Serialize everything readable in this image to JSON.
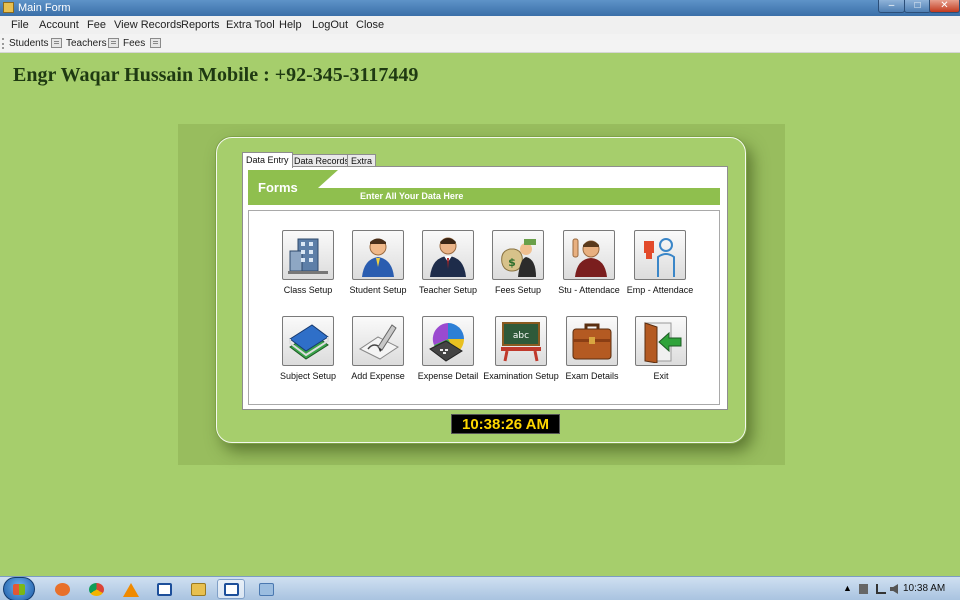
{
  "window": {
    "title": "Main Form",
    "controls": {
      "minimize": "–",
      "maximize": "□",
      "close": "✕"
    }
  },
  "menu": [
    "File",
    "Account",
    "Fee",
    "View Records",
    "Reports",
    "Extra Tool",
    "Help",
    "LogOut",
    "Close"
  ],
  "toolbar": [
    "Students",
    "Teachers",
    "Fees"
  ],
  "contact_text": "Engr Waqar Hussain Mobile : +92-345-3117449",
  "tabs": [
    "Data Entry",
    "Data Records",
    "Extra"
  ],
  "active_tab": "Data Entry",
  "banner": {
    "title": "Forms",
    "subtitle": "Enter All Your Data Here"
  },
  "tiles": [
    {
      "label": "Class Setup",
      "icon": "building-icon"
    },
    {
      "label": "Student Setup",
      "icon": "student-icon"
    },
    {
      "label": "Teacher Setup",
      "icon": "teacher-icon"
    },
    {
      "label": "Fees Setup",
      "icon": "money-bag-icon"
    },
    {
      "label": "Stu - Attendace",
      "icon": "raised-hand-icon"
    },
    {
      "label": "Emp - Attendace",
      "icon": "employee-icon"
    },
    {
      "label": "Subject Setup",
      "icon": "books-icon"
    },
    {
      "label": "Add Expense",
      "icon": "pencil-paper-icon"
    },
    {
      "label": "Expense Detail",
      "icon": "calculator-chart-icon"
    },
    {
      "label": "Examination Setup",
      "icon": "blackboard-icon"
    },
    {
      "label": "Exam Details",
      "icon": "briefcase-icon"
    },
    {
      "label": "Exit",
      "icon": "exit-door-icon"
    }
  ],
  "clock": "10:38:26 AM",
  "taskbar": {
    "time": "10:38 AM",
    "apps": [
      "firefox-icon",
      "chrome-icon",
      "vlc-icon",
      "window-icon",
      "explorer-icon",
      "main-form-icon",
      "app-icon"
    ]
  },
  "colors": {
    "background": "#a6ce6c",
    "banner": "#8fbf4e",
    "clock_text": "#ffd700",
    "heading_text": "#1f3a12"
  }
}
